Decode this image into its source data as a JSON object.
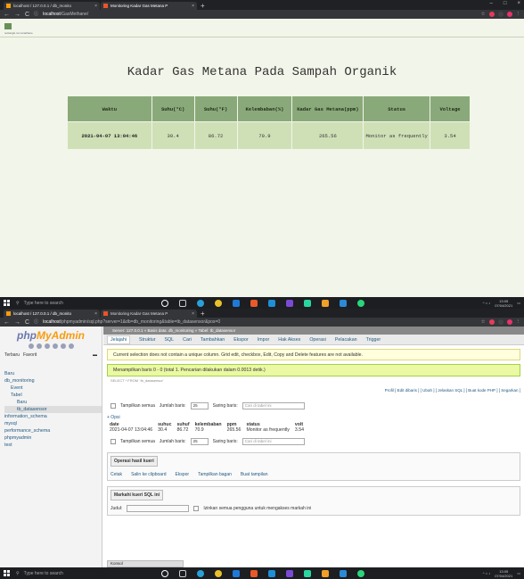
{
  "browser1": {
    "tabs": [
      {
        "label": "localhost / 127.0.0.1 / db_monito",
        "close": "×"
      },
      {
        "label": "Monitoring Kadar Gas Metana P",
        "close": "×"
      }
    ],
    "new_tab": "+",
    "window_controls": [
      "–",
      "□",
      "×"
    ],
    "url_prefix": "localhost",
    "url_path": "/GasMethane/"
  },
  "app": {
    "menu_text": "rectangle ran amathane",
    "title": "Kadar Gas Metana Pada Sampah Organik",
    "columns": [
      "Waktu",
      "Suhu(°C)",
      "Suhu(°F)",
      "Kelembaban(%)",
      "Kadar Gas Metana(ppm)",
      "Status",
      "Voltage"
    ],
    "rows": [
      {
        "waktu": "2021-04-07 13:04:46",
        "suhu_c": "30.4",
        "suhu_f": "86.72",
        "kelembaban": "70.9",
        "ppm": "265.56",
        "status": "Monitor as frequently",
        "voltage": "3.54"
      }
    ]
  },
  "taskbar": {
    "search_placeholder": "Type here to search",
    "time": "13:05",
    "date": "07/04/2021"
  },
  "browser2": {
    "tabs": [
      {
        "label": "localhost / 127.0.0.1 / db_monito",
        "close": "×"
      },
      {
        "label": "Monitoring Kadar Gas Metana P",
        "close": "×"
      }
    ],
    "new_tab": "+",
    "url_prefix": "localhost",
    "url_path": "/phpmyadmin/sql.php?server=1&db=db_monitoring&table=tb_datasensor&pos=0"
  },
  "pma": {
    "logo_php": "php",
    "logo_my": "MyAdmin",
    "side_tabs": [
      "Terbaru",
      "Favorit"
    ],
    "tree": [
      "Baru",
      "db_monitoring",
      "Event",
      "Tabel",
      "Baru",
      "tb_datasensor",
      "information_schema",
      "mysql",
      "performance_schema",
      "phpmyadmin",
      "test"
    ],
    "server_bar": "Server: 127.0.0.1 » Basis data: db_monitoring » Tabel: tb_datasensor",
    "tabs": [
      "Jelajahi",
      "Struktur",
      "SQL",
      "Cari",
      "Tambahkan",
      "Ekspor",
      "Impor",
      "Hak Akses",
      "Operasi",
      "Pelacakan",
      "Trigger"
    ],
    "notice": "Current selection does not contain a unique column. Grid edit, checkbox, Edit, Copy and Delete features are not available.",
    "success": "Menampilkan baris 0 - 0 (total 1. Pencarian dilakukan dalam 0.0013 detik.)",
    "sql": "SELECT * FROM `tb_datasensor`",
    "profile": "Profil [ Edit dibaris ] [ Ubah ] [ Jelaskan SQL ] [ Buat kode PHP ] [ Segarkan ]",
    "show_all": "Tampilkan semua",
    "row_count_label": "Jumlah baris:",
    "row_count": "25",
    "filter_label": "Saring baris:",
    "filter_placeholder": "Cari di tabel ini",
    "opsi": "+ Opsi",
    "result_cols": [
      "date",
      "suhuc",
      "suhuf",
      "kelembaban",
      "ppm",
      "status",
      "volt"
    ],
    "result_row": [
      "2021-04-07 13:04:46",
      "30.4",
      "86.72",
      "70.9",
      "265.56",
      "Monitor as frequently",
      "3.54"
    ],
    "ops_title": "Operasi hasil kueri",
    "ops_actions": [
      "Cetak",
      "Salin ke clipboard",
      "Ekspor",
      "Tampilkan bagan",
      "Buat tampilan"
    ],
    "bookmark_title": "Markahi kueri SQL ini",
    "bookmark_label": "Judul:",
    "bookmark_share": "Izinkan semua pengguna untuk mengakses markah ini",
    "console": "Konsol"
  }
}
